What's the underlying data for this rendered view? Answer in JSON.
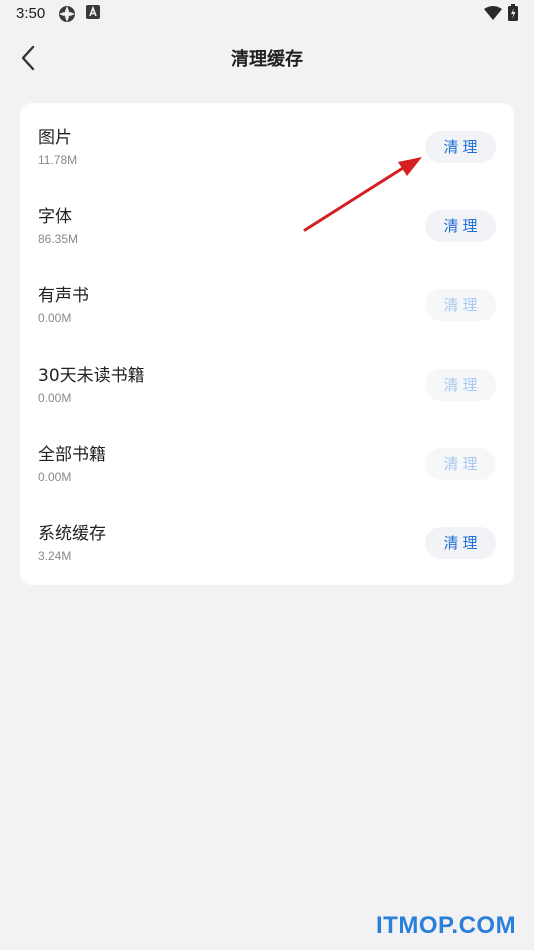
{
  "status_bar": {
    "time": "3:50",
    "icons": [
      "settings-gear-icon",
      "a-badge-icon",
      "wifi-icon",
      "battery-charging-icon"
    ]
  },
  "header": {
    "title": "清理缓存",
    "back_icon": "chevron-left-icon"
  },
  "items": [
    {
      "name": "图片",
      "size": "11.78M",
      "button": "清理",
      "enabled": true
    },
    {
      "name": "字体",
      "size": "86.35M",
      "button": "清理",
      "enabled": true
    },
    {
      "name": "有声书",
      "size": "0.00M",
      "button": "清理",
      "enabled": false
    },
    {
      "name": "30天未读书籍",
      "size": "0.00M",
      "button": "清理",
      "enabled": false
    },
    {
      "name": "全部书籍",
      "size": "0.00M",
      "button": "清理",
      "enabled": false
    },
    {
      "name": "系统缓存",
      "size": "3.24M",
      "button": "清理",
      "enabled": true
    }
  ],
  "annotation": {
    "icon": "red-arrow-icon",
    "color": "#d42020"
  },
  "watermark": {
    "text": "ITMOP.COM"
  },
  "colors": {
    "accent": "#1f6fd8",
    "accent_disabled": "#a9c9f0",
    "background": "#f2f2f5",
    "card": "#ffffff"
  }
}
